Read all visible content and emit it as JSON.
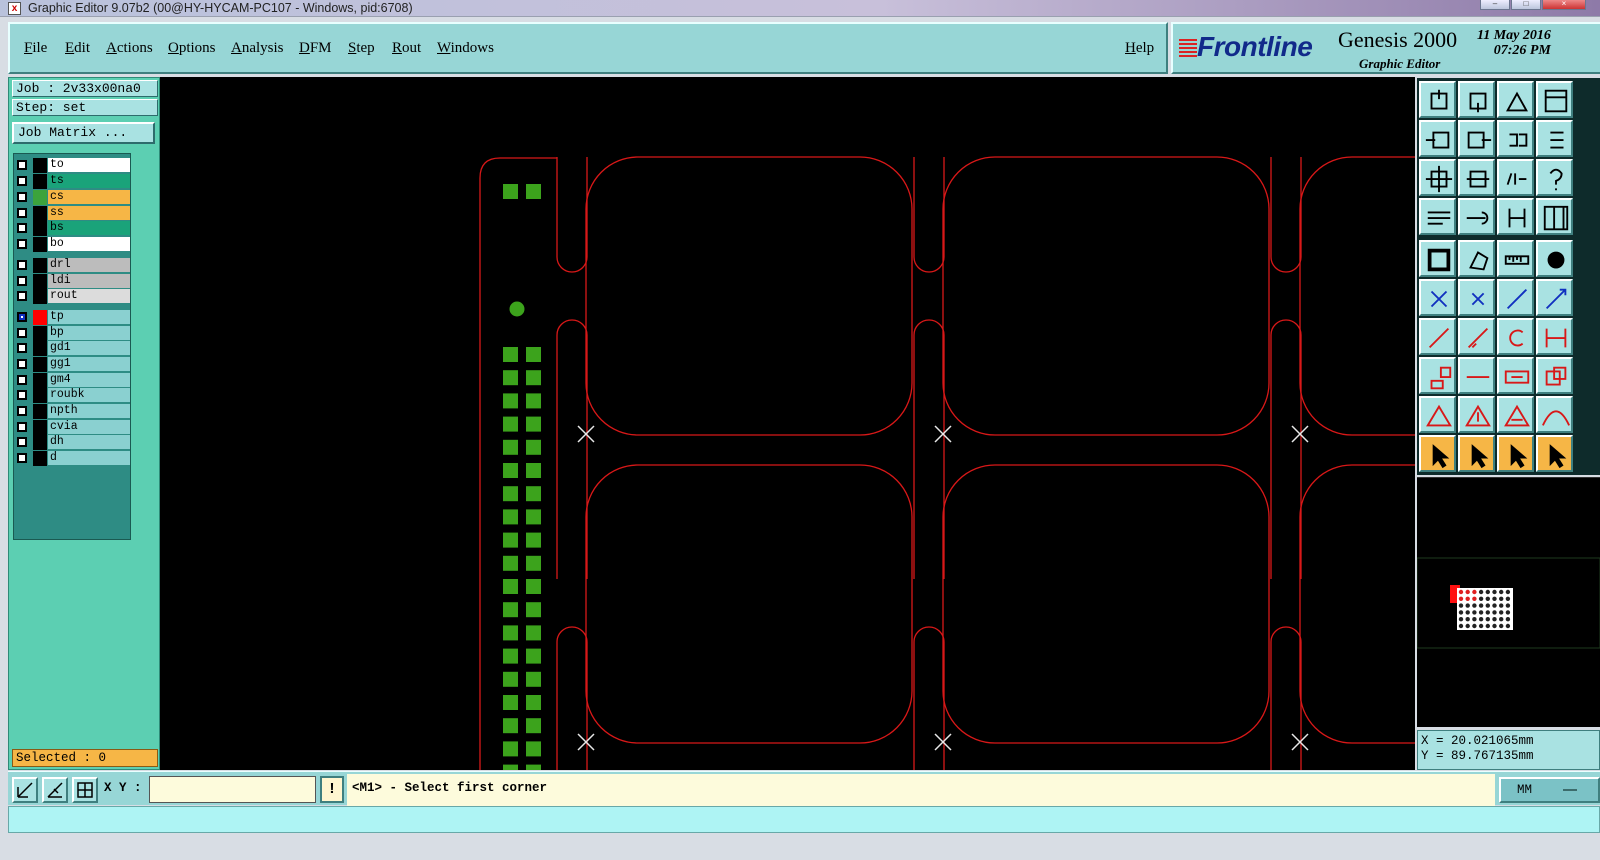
{
  "window": {
    "title": "Graphic Editor 9.07b2 (00@HY-HYCAM-PC107 - Windows, pid:6708)",
    "icon": "x-app-icon"
  },
  "menu": {
    "items": [
      "File",
      "Edit",
      "Actions",
      "Options",
      "Analysis",
      "DFM",
      "Step",
      "Rout",
      "Windows"
    ],
    "help": "Help"
  },
  "brand": {
    "logo": "Frontline",
    "product": "Genesis 2000",
    "subtitle": "Graphic Editor",
    "date": "11 May 2016",
    "time": "07:26 PM"
  },
  "job": {
    "job_label": "Job : 2v33x00na0",
    "step_label": "Step: set",
    "matrix_button": "Job Matrix ..."
  },
  "layers": [
    {
      "name": "to",
      "bg": "#ffffff",
      "swatch": "#000000"
    },
    {
      "name": "ts",
      "bg": "#1aa37a",
      "swatch": "#000000"
    },
    {
      "name": "cs",
      "bg": "#f6b646",
      "swatch": "#3ca33c"
    },
    {
      "name": "ss",
      "bg": "#f6b646",
      "swatch": "#000000"
    },
    {
      "name": "bs",
      "bg": "#1aa37a",
      "swatch": "#000000"
    },
    {
      "name": "bo",
      "bg": "#ffffff",
      "swatch": "#000000"
    },
    {
      "name": "drl",
      "bg": "#bcbcbc",
      "swatch": "#000000"
    },
    {
      "name": "ldi",
      "bg": "#bcbcbc",
      "swatch": "#000000"
    },
    {
      "name": "rout",
      "bg": "#dcdcdc",
      "swatch": "#000000"
    },
    {
      "name": "tp",
      "bg": "#8ad0d0",
      "swatch": "#ff0000",
      "active": true
    },
    {
      "name": "bp",
      "bg": "#8ad0d0",
      "swatch": "#000000"
    },
    {
      "name": "gd1",
      "bg": "#8ad0d0",
      "swatch": "#000000"
    },
    {
      "name": "gg1",
      "bg": "#8ad0d0",
      "swatch": "#000000"
    },
    {
      "name": "gm4",
      "bg": "#8ad0d0",
      "swatch": "#000000"
    },
    {
      "name": "roubk",
      "bg": "#8ad0d0",
      "swatch": "#000000"
    },
    {
      "name": "npth",
      "bg": "#8ad0d0",
      "swatch": "#000000"
    },
    {
      "name": "cvia",
      "bg": "#8ad0d0",
      "swatch": "#000000"
    },
    {
      "name": "dh",
      "bg": "#8ad0d0",
      "swatch": "#000000"
    },
    {
      "name": "d",
      "bg": "#8ad0d0",
      "swatch": "#000000"
    }
  ],
  "selection": {
    "label": "Selected : 0"
  },
  "tools": [
    "move-up-icon",
    "move-down-icon",
    "home-icon",
    "window-icon",
    "move-left-icon",
    "move-right-icon",
    "swap-icon",
    "snap-icon",
    "zoom-fit-icon",
    "zoom-center-icon",
    "scale-1-2-icon",
    "help-icon",
    "ruler-icon",
    "probe-icon",
    "layers-icon",
    "grid-icon",
    "feature-box-icon",
    "polygon-icon",
    "measure-icon",
    "pad-icon",
    "connect-icon",
    "delete-icon",
    "move-node-icon",
    "add-node-icon",
    "line-icon",
    "arc-line-icon",
    "rotate-icon",
    "mirror-icon",
    "copy-icon",
    "break-icon",
    "stretch-icon",
    "attributes-icon",
    "triangle-icon",
    "triangle-up-icon",
    "triangle-a-icon",
    "triangle-arc-icon",
    "select-icon",
    "select-box-icon",
    "select-circle-icon",
    "select-net-icon"
  ],
  "coords": {
    "x_label": "X = 20.021065mm",
    "y_label": "Y = 89.767135mm"
  },
  "command": {
    "xy_label": "X Y :",
    "xy_value": "",
    "warn": "!",
    "prompt": "<M1> - Select first corner",
    "units": "MM"
  },
  "colors": {
    "canvas": "#000000",
    "outline": "#d81818",
    "pads": "#3ca31c",
    "panel": "#5ccfb2",
    "toolbar": "#97d6d6",
    "selected": "#f6b646"
  }
}
